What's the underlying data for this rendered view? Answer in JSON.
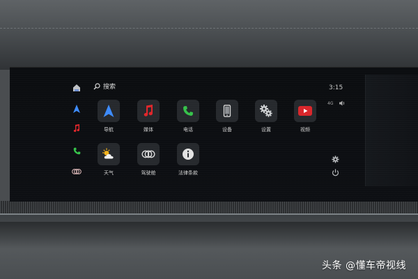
{
  "search": {
    "label": "搜索"
  },
  "tiles": [
    {
      "label": "导航",
      "icon": "navigation-arrow-icon",
      "color": "#3d8bfd"
    },
    {
      "label": "媒体",
      "icon": "music-note-icon",
      "color": "#e0262b"
    },
    {
      "label": "电话",
      "icon": "phone-icon",
      "color": "#36c24a"
    },
    {
      "label": "设备",
      "icon": "device-phone-icon",
      "color": "#d8d8d8"
    },
    {
      "label": "设置",
      "icon": "gears-icon",
      "color": "#d8d8d8"
    },
    {
      "label": "视频",
      "icon": "video-play-icon",
      "color": "#d9262b"
    },
    {
      "label": "天气",
      "icon": "weather-sun-cloud-icon",
      "color": "#f3b21a"
    },
    {
      "label": "驾驶舱",
      "icon": "cockpit-rings-icon",
      "color": "#d8d8d8"
    },
    {
      "label": "法律条款",
      "icon": "info-icon",
      "color": "#d8d8d8"
    }
  ],
  "dock": [
    {
      "icon": "home-icon"
    },
    {
      "icon": "navigation-arrow-icon"
    },
    {
      "icon": "music-note-icon"
    },
    {
      "icon": "phone-icon"
    },
    {
      "icon": "cockpit-rings-icon"
    }
  ],
  "status": {
    "time": "3:15",
    "network": "4G"
  },
  "watermark": "头条 @懂车帝视线"
}
